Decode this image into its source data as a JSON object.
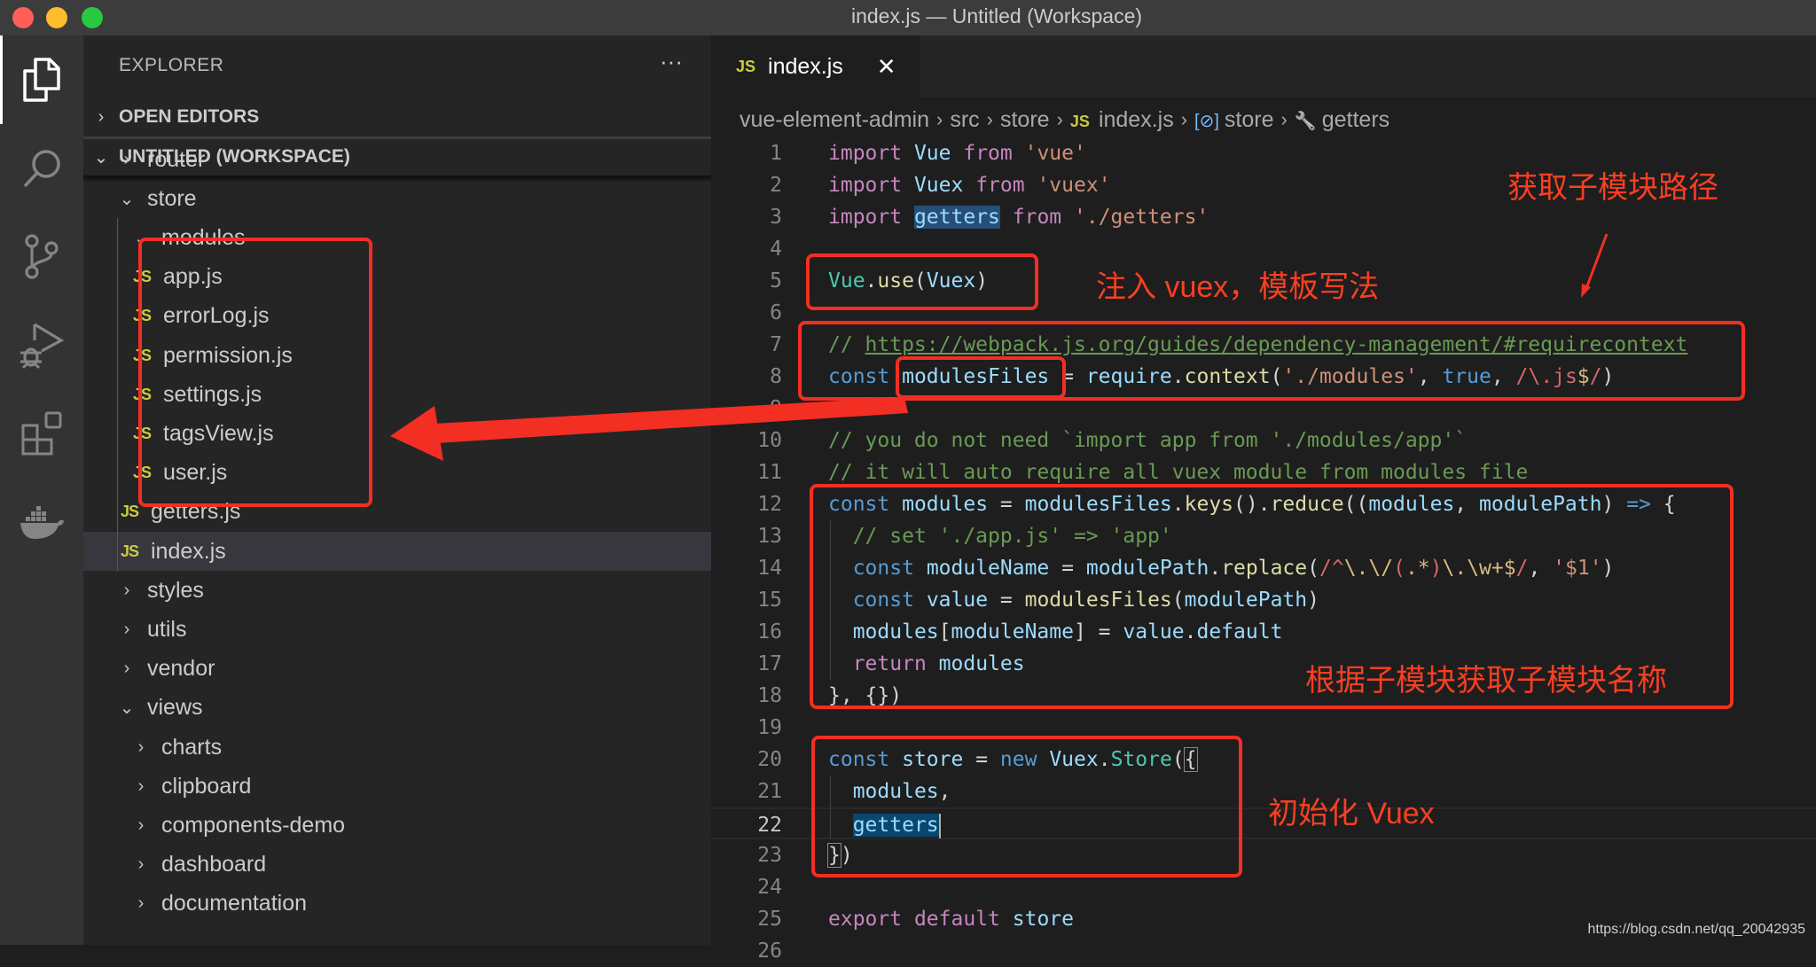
{
  "window": {
    "title": "index.js — Untitled (Workspace)",
    "traffic_lights": {
      "close": "#ff5f57",
      "minimize": "#febc2e",
      "zoom": "#28c840"
    }
  },
  "activity_bar": {
    "items": [
      {
        "name": "explorer",
        "icon": "files-icon",
        "active": true
      },
      {
        "name": "search",
        "icon": "search-icon",
        "active": false
      },
      {
        "name": "source-control",
        "icon": "source-control-icon",
        "active": false
      },
      {
        "name": "run-debug",
        "icon": "run-debug-icon",
        "active": false
      },
      {
        "name": "extensions",
        "icon": "extensions-icon",
        "active": false
      },
      {
        "name": "docker",
        "icon": "docker-icon",
        "active": false
      }
    ]
  },
  "sidebar": {
    "title": "EXPLORER",
    "more_label": "···",
    "sections": [
      {
        "label": "OPEN EDITORS",
        "expanded": false
      },
      {
        "label": "UNTITLED (WORKSPACE)",
        "expanded": true
      }
    ],
    "tree": [
      {
        "label": "router",
        "type": "folder",
        "expanded": false,
        "depth": 1
      },
      {
        "label": "store",
        "type": "folder",
        "expanded": true,
        "depth": 1
      },
      {
        "label": "modules",
        "type": "folder",
        "expanded": true,
        "depth": 2
      },
      {
        "label": "app.js",
        "type": "js",
        "depth": 3
      },
      {
        "label": "errorLog.js",
        "type": "js",
        "depth": 3
      },
      {
        "label": "permission.js",
        "type": "js",
        "depth": 3
      },
      {
        "label": "settings.js",
        "type": "js",
        "depth": 3
      },
      {
        "label": "tagsView.js",
        "type": "js",
        "depth": 3
      },
      {
        "label": "user.js",
        "type": "js",
        "depth": 3
      },
      {
        "label": "getters.js",
        "type": "js",
        "depth": 2
      },
      {
        "label": "index.js",
        "type": "js",
        "depth": 2,
        "selected": true
      },
      {
        "label": "styles",
        "type": "folder",
        "expanded": false,
        "depth": 1
      },
      {
        "label": "utils",
        "type": "folder",
        "expanded": false,
        "depth": 1
      },
      {
        "label": "vendor",
        "type": "folder",
        "expanded": false,
        "depth": 1
      },
      {
        "label": "views",
        "type": "folder",
        "expanded": true,
        "depth": 1
      },
      {
        "label": "charts",
        "type": "folder",
        "expanded": false,
        "depth": 2
      },
      {
        "label": "clipboard",
        "type": "folder",
        "expanded": false,
        "depth": 2
      },
      {
        "label": "components-demo",
        "type": "folder",
        "expanded": false,
        "depth": 2
      },
      {
        "label": "dashboard",
        "type": "folder",
        "expanded": false,
        "depth": 2
      },
      {
        "label": "documentation",
        "type": "folder",
        "expanded": false,
        "depth": 2
      }
    ]
  },
  "editor": {
    "tab": {
      "icon_label": "JS",
      "label": "index.js",
      "close_label": "✕"
    },
    "breadcrumbs": [
      {
        "label": "vue-element-admin"
      },
      {
        "label": "src"
      },
      {
        "label": "store"
      },
      {
        "label": "index.js",
        "icon_label": "JS"
      },
      {
        "label": "store",
        "icon": "variable-icon",
        "icon_label": "[⊘]"
      },
      {
        "label": "getters",
        "icon": "wrench-icon",
        "icon_label": "🔧"
      }
    ],
    "current_line": 22,
    "lines": [
      {
        "n": "1",
        "tokens": [
          [
            "kw",
            "import"
          ],
          [
            "",
            " "
          ],
          [
            "var",
            "Vue"
          ],
          [
            "",
            " "
          ],
          [
            "kw",
            "from"
          ],
          [
            "",
            " "
          ],
          [
            "str",
            "'vue'"
          ]
        ]
      },
      {
        "n": "2",
        "tokens": [
          [
            "kw",
            "import"
          ],
          [
            "",
            " "
          ],
          [
            "var",
            "Vuex"
          ],
          [
            "",
            " "
          ],
          [
            "kw",
            "from"
          ],
          [
            "",
            " "
          ],
          [
            "str",
            "'vuex'"
          ]
        ]
      },
      {
        "n": "3",
        "tokens": [
          [
            "kw",
            "import"
          ],
          [
            "",
            " "
          ],
          [
            "var hl",
            "getters"
          ],
          [
            "",
            " "
          ],
          [
            "kw",
            "from"
          ],
          [
            "",
            " "
          ],
          [
            "str",
            "'./getters'"
          ]
        ]
      },
      {
        "n": "4",
        "tokens": []
      },
      {
        "n": "5",
        "tokens": [
          [
            "cls",
            "Vue"
          ],
          [
            "",
            "."
          ],
          [
            "fn",
            "use"
          ],
          [
            "",
            "("
          ],
          [
            "var",
            "Vuex"
          ],
          [
            "",
            ")"
          ]
        ]
      },
      {
        "n": "6",
        "tokens": []
      },
      {
        "n": "7",
        "tokens": [
          [
            "com",
            "// "
          ],
          [
            "link",
            "https://webpack.js.org/guides/dependency-management/#requirecontext"
          ]
        ]
      },
      {
        "n": "8",
        "tokens": [
          [
            "st",
            "const"
          ],
          [
            "",
            " "
          ],
          [
            "var",
            "modulesFiles"
          ],
          [
            "",
            " = "
          ],
          [
            "var",
            "require"
          ],
          [
            "",
            "."
          ],
          [
            "fn",
            "context"
          ],
          [
            "",
            "("
          ],
          [
            "str",
            "'./modules'"
          ],
          [
            "",
            ", "
          ],
          [
            "st",
            "true"
          ],
          [
            "",
            ", "
          ],
          [
            "re",
            "/\\."
          ],
          [
            "re",
            "js"
          ],
          [
            "rex",
            "$"
          ],
          [
            "re",
            "/"
          ],
          [
            "",
            ")"
          ]
        ]
      },
      {
        "n": "9",
        "tokens": []
      },
      {
        "n": "10",
        "tokens": [
          [
            "com",
            "// you do not need `import app from './modules/app'`"
          ]
        ]
      },
      {
        "n": "11",
        "tokens": [
          [
            "com",
            "// it will auto require all vuex module from modules file"
          ]
        ]
      },
      {
        "n": "12",
        "tokens": [
          [
            "st",
            "const"
          ],
          [
            "",
            " "
          ],
          [
            "var",
            "modules"
          ],
          [
            "",
            " = "
          ],
          [
            "var",
            "modulesFiles"
          ],
          [
            "",
            "."
          ],
          [
            "fn",
            "keys"
          ],
          [
            "",
            "()."
          ],
          [
            "fn",
            "reduce"
          ],
          [
            "",
            "(("
          ],
          [
            "var",
            "modules"
          ],
          [
            "",
            ", "
          ],
          [
            "var",
            "modulePath"
          ],
          [
            "",
            ") "
          ],
          [
            "st",
            "=>"
          ],
          [
            "",
            " {"
          ]
        ]
      },
      {
        "n": "13",
        "tokens": [
          [
            "",
            "  "
          ],
          [
            "com",
            "// set './app.js' => 'app'"
          ]
        ]
      },
      {
        "n": "14",
        "tokens": [
          [
            "",
            "  "
          ],
          [
            "st",
            "const"
          ],
          [
            "",
            " "
          ],
          [
            "var",
            "moduleName"
          ],
          [
            "",
            " = "
          ],
          [
            "var",
            "modulePath"
          ],
          [
            "",
            "."
          ],
          [
            "fn",
            "replace"
          ],
          [
            "",
            "("
          ],
          [
            "re",
            "/^"
          ],
          [
            "rex",
            "\\.\\/"
          ],
          [
            "re",
            "("
          ],
          [
            "rex",
            ".*"
          ],
          [
            "re",
            ")"
          ],
          [
            "rex",
            "\\.\\w+$"
          ],
          [
            "re",
            "/"
          ],
          [
            "",
            ", "
          ],
          [
            "str",
            "'$1'"
          ],
          [
            "",
            ")"
          ]
        ]
      },
      {
        "n": "15",
        "tokens": [
          [
            "",
            "  "
          ],
          [
            "st",
            "const"
          ],
          [
            "",
            " "
          ],
          [
            "var",
            "value"
          ],
          [
            "",
            " = "
          ],
          [
            "fn",
            "modulesFiles"
          ],
          [
            "",
            "("
          ],
          [
            "var",
            "modulePath"
          ],
          [
            "",
            ")"
          ]
        ]
      },
      {
        "n": "16",
        "tokens": [
          [
            "",
            "  "
          ],
          [
            "var",
            "modules"
          ],
          [
            "",
            "["
          ],
          [
            "var",
            "moduleName"
          ],
          [
            "",
            "] = "
          ],
          [
            "var",
            "value"
          ],
          [
            "",
            "."
          ],
          [
            "var",
            "default"
          ]
        ]
      },
      {
        "n": "17",
        "tokens": [
          [
            "",
            "  "
          ],
          [
            "kw",
            "return"
          ],
          [
            "",
            " "
          ],
          [
            "var",
            "modules"
          ]
        ]
      },
      {
        "n": "18",
        "tokens": [
          [
            "",
            "}, {})"
          ]
        ]
      },
      {
        "n": "19",
        "tokens": []
      },
      {
        "n": "20",
        "tokens": [
          [
            "st",
            "const"
          ],
          [
            "",
            " "
          ],
          [
            "var",
            "store"
          ],
          [
            "",
            " = "
          ],
          [
            "st",
            "new"
          ],
          [
            "",
            " "
          ],
          [
            "var",
            "Vuex"
          ],
          [
            "",
            "."
          ],
          [
            "cls",
            "Store"
          ],
          [
            "",
            "("
          ],
          [
            "bm",
            "{"
          ]
        ]
      },
      {
        "n": "21",
        "tokens": [
          [
            "",
            "  "
          ],
          [
            "var",
            "modules"
          ],
          [
            "",
            ","
          ]
        ]
      },
      {
        "n": "22",
        "tokens": [
          [
            "",
            "  "
          ],
          [
            "var hl2",
            "getters"
          ],
          [
            "cursor",
            ""
          ]
        ]
      },
      {
        "n": "23",
        "tokens": [
          [
            "bm",
            "}"
          ],
          [
            "",
            ")"
          ]
        ]
      },
      {
        "n": "24",
        "tokens": []
      },
      {
        "n": "25",
        "tokens": [
          [
            "kw",
            "export"
          ],
          [
            "",
            " "
          ],
          [
            "kw",
            "default"
          ],
          [
            "",
            " "
          ],
          [
            "var",
            "store"
          ]
        ]
      },
      {
        "n": "26",
        "tokens": []
      }
    ]
  },
  "annotations": {
    "color": "#f22f22",
    "get_submodule_path": "获取子模块路径",
    "inject_vuex": "注入 vuex，模板写法",
    "get_submodule_name": "根据子模块获取子模块名称",
    "init_vuex": "初始化 Vuex"
  },
  "watermark": "https://blog.csdn.net/qq_20042935"
}
